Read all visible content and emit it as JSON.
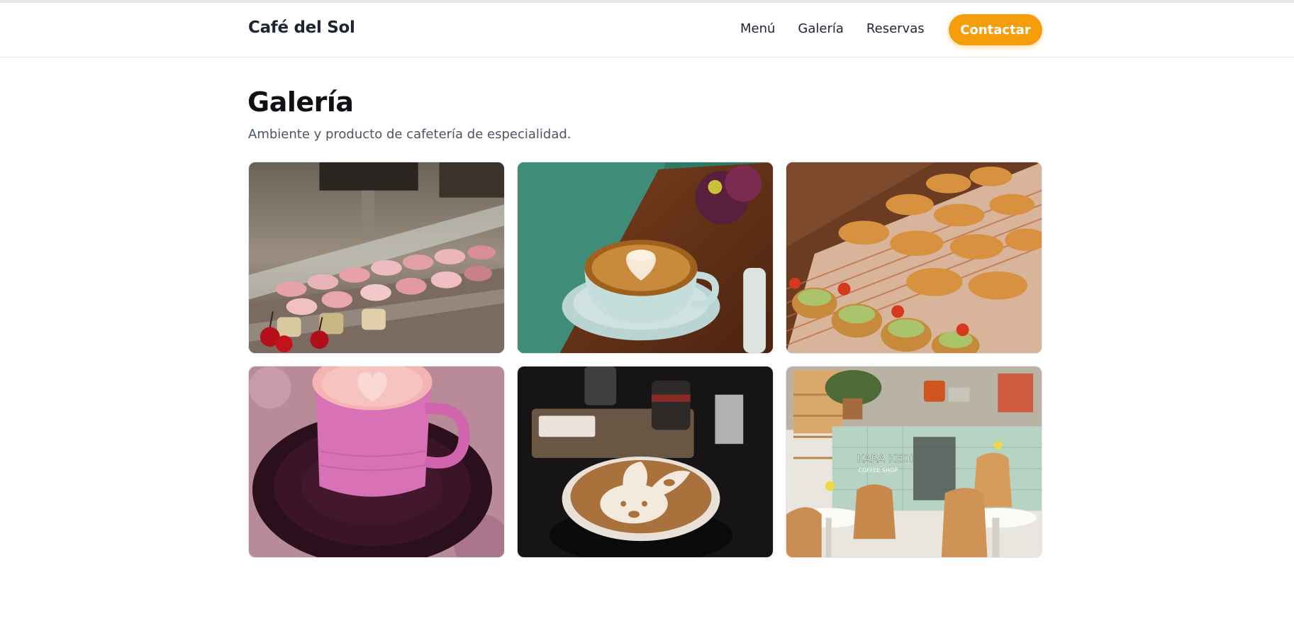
{
  "header": {
    "brand": "Café del Sol",
    "nav": [
      {
        "label": "Menú"
      },
      {
        "label": "Galería"
      },
      {
        "label": "Reservas"
      }
    ],
    "cta_label": "Contactar",
    "accent_color": "#f59e0b"
  },
  "main": {
    "title": "Galería",
    "subtitle": "Ambiente y producto de cafetería de especialidad.",
    "gallery": [
      {
        "icon": "pastry-display-case-photo"
      },
      {
        "icon": "latte-art-heart-photo"
      },
      {
        "icon": "croissants-tray-photo"
      },
      {
        "icon": "pink-latte-cup-photo"
      },
      {
        "icon": "bunny-latte-art-photo"
      },
      {
        "icon": "coffee-shop-interior-photo",
        "sign_text": "KARA KEDI COFFEE SHOP"
      }
    ]
  }
}
